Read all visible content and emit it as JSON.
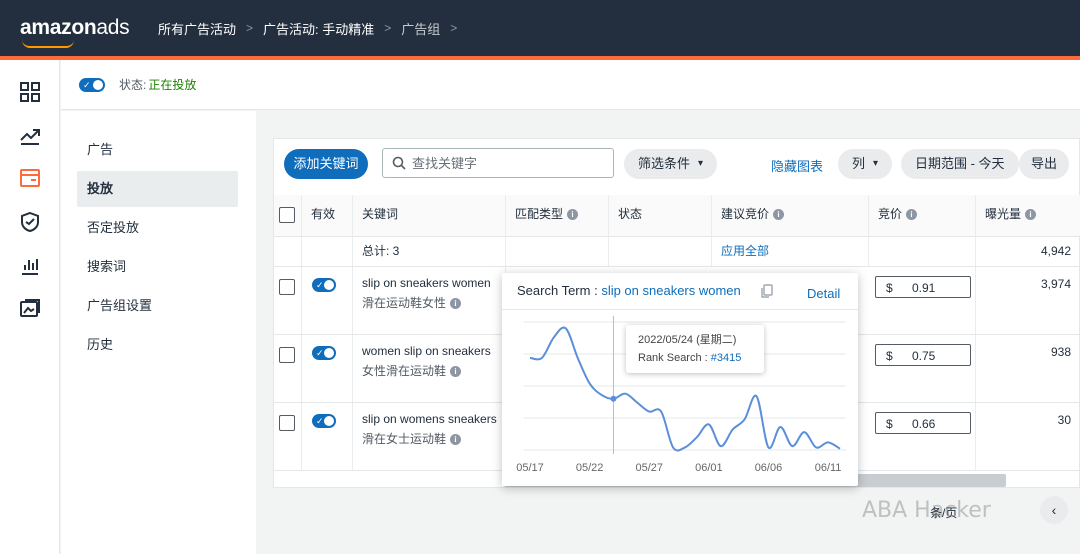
{
  "header": {
    "logo_main": "amazon",
    "logo_suffix": "ads",
    "breadcrumbs": [
      "所有广告活动",
      "广告活动: 手动精准",
      "广告组"
    ],
    "accent_color": "#ff6a3d"
  },
  "rail": {
    "icons": [
      "dashboard-icon",
      "trend-icon",
      "campaign-icon",
      "shield-icon",
      "bar-chart-icon",
      "image-icon"
    ]
  },
  "status": {
    "label": "状态:",
    "value": "正在投放"
  },
  "subnav": {
    "items": [
      "广告",
      "投放",
      "否定投放",
      "搜索词",
      "广告组设置",
      "历史"
    ],
    "active_index": 1
  },
  "toolbar": {
    "add_keyword": "添加关键词",
    "search_placeholder": "查找关键字",
    "filter": "筛选条件",
    "hide_chart": "隐藏图表",
    "columns": "列",
    "date_range": "日期范围 - 今天",
    "export": "导出"
  },
  "table": {
    "headers": {
      "active": "有效",
      "keyword": "关键词",
      "match_type": "匹配类型",
      "status": "状态",
      "suggested_bid": "建议竞价",
      "bid": "竞价",
      "impressions": "曝光量"
    },
    "total": {
      "label": "总计: 3",
      "apply_all": "应用全部",
      "impressions": "4,942"
    },
    "rows": [
      {
        "keyword_en": "slip on sneakers women",
        "keyword_zh": "滑在运动鞋女性",
        "currency": "$",
        "bid": "0.91",
        "impressions": "3,974"
      },
      {
        "keyword_en": "women slip on sneakers",
        "keyword_zh": "女性滑在运动鞋",
        "currency": "$",
        "bid": "0.75",
        "impressions": "938"
      },
      {
        "keyword_en": "slip on womens sneakers",
        "keyword_zh": "滑在女士运动鞋",
        "currency": "$",
        "bid": "0.66",
        "impressions": "30"
      }
    ]
  },
  "popup": {
    "title_prefix": "Search Term :",
    "term": "slip on sneakers women",
    "detail": "Detail",
    "tooltip_date": "2022/05/24 (星期二)",
    "tooltip_rank_label": "Rank Search :",
    "tooltip_rank_value": "#3415"
  },
  "chart_data": {
    "type": "line",
    "x": [
      "05/17",
      "05/18",
      "05/19",
      "05/20",
      "05/21",
      "05/22",
      "05/23",
      "05/24",
      "05/25",
      "05/26",
      "05/27",
      "05/28",
      "05/29",
      "05/30",
      "05/31",
      "06/01",
      "06/02",
      "06/03",
      "06/04",
      "06/05",
      "06/06",
      "06/07",
      "06/08",
      "06/09",
      "06/10",
      "06/11",
      "06/12"
    ],
    "x_tick_labels": [
      "05/17",
      "05/22",
      "05/27",
      "06/01",
      "06/06",
      "06/11"
    ],
    "values": [
      0.72,
      0.72,
      0.88,
      0.95,
      0.72,
      0.52,
      0.43,
      0.4,
      0.44,
      0.37,
      0.3,
      0.3,
      0.02,
      0.02,
      0.1,
      0.2,
      0.03,
      0.16,
      0.24,
      0.42,
      0.02,
      0.18,
      0.03,
      0.14,
      0.02,
      0.06,
      0.01
    ],
    "highlight_index": 7,
    "ylim": [
      0,
      1
    ],
    "grid": true,
    "line_color": "#5b8fd9"
  },
  "watermark": {
    "text": "ABA Hacker",
    "sub": "条/页"
  }
}
